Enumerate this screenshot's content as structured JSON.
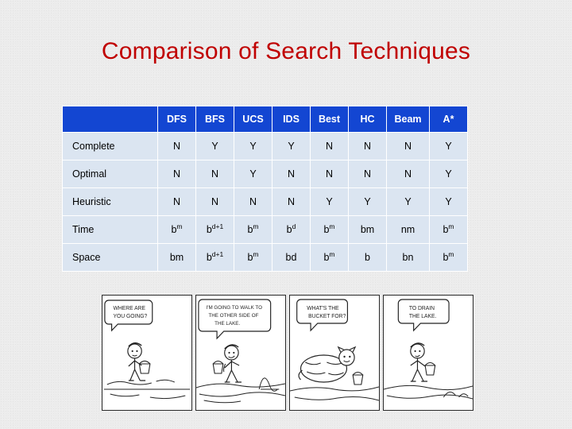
{
  "slide": {
    "title": "Comparison of Search Techniques",
    "title_color": "#c00000",
    "background_color": "#ececec"
  },
  "table": {
    "header_background": "#1346d2",
    "header_text_color": "#ffffff",
    "cell_background": "#dbe5f1",
    "corner_label": "",
    "columns": [
      "DFS",
      "BFS",
      "UCS",
      "IDS",
      "Best",
      "HC",
      "Beam",
      "A*"
    ],
    "rows": [
      {
        "label": "Complete",
        "cells": [
          "N",
          "Y",
          "Y",
          "Y",
          "N",
          "N",
          "N",
          "Y"
        ]
      },
      {
        "label": "Optimal",
        "cells": [
          "N",
          "N",
          "Y",
          "N",
          "N",
          "N",
          "N",
          "Y"
        ]
      },
      {
        "label": "Heuristic",
        "cells": [
          "N",
          "N",
          "N",
          "N",
          "Y",
          "Y",
          "Y",
          "Y"
        ]
      },
      {
        "label": "Time",
        "cells": [
          "b^m",
          "b^d+1",
          "b^m",
          "b^d",
          "b^m",
          "bm",
          "nm",
          "b^m"
        ],
        "cells_base": [
          "b",
          "b",
          "b",
          "b",
          "b",
          "bm",
          "nm",
          "b"
        ],
        "cells_sup": [
          "m",
          "d+1",
          "m",
          "d",
          "m",
          "",
          "",
          "m"
        ]
      },
      {
        "label": "Space",
        "cells": [
          "bm",
          "b^d+1",
          "b^m",
          "bd",
          "b^m",
          "b",
          "bn",
          "b^m"
        ],
        "cells_base": [
          "bm",
          "b",
          "b",
          "bd",
          "b",
          "b",
          "bn",
          "b"
        ],
        "cells_sup": [
          "",
          "d+1",
          "m",
          "",
          "m",
          "",
          "",
          "m"
        ]
      }
    ]
  },
  "comic": {
    "panels": [
      {
        "caption": "WHERE ARE YOU GOING?"
      },
      {
        "caption": "I'M GOING TO WALK TO THE OTHER SIDE OF THE LAKE."
      },
      {
        "caption": "WHAT'S THE BUCKET FOR?"
      },
      {
        "caption": "TO DRAIN THE LAKE."
      }
    ]
  }
}
